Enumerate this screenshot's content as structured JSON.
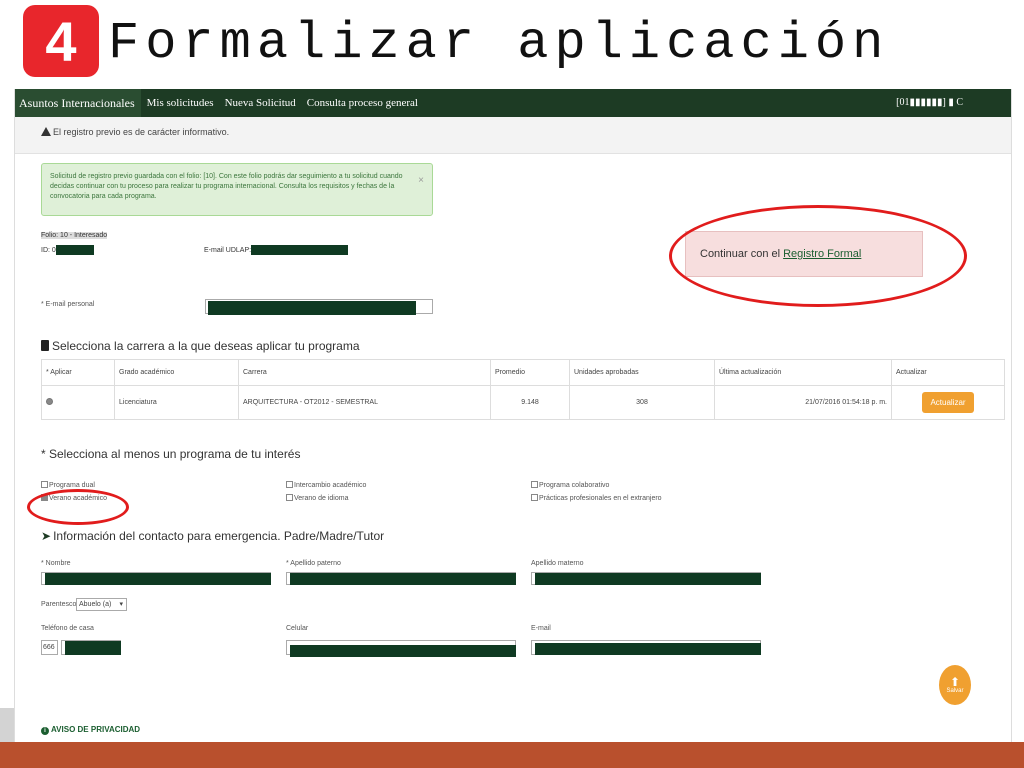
{
  "slide": {
    "step_number": "4",
    "title": "Formalizar aplicación"
  },
  "nav": {
    "brand": "Asuntos Internacionales",
    "links": [
      "Mis solicitudes",
      "Nueva Solicitud",
      "Consulta proceso general"
    ],
    "user": "[01▮▮▮▮▮▮] ▮ C"
  },
  "notice": {
    "text": "El registro previo es de carácter informativo.",
    "icon": "warning-icon"
  },
  "alert": {
    "text": "Solicitud de registro previo guardada con el folio: [10]. Con este folio podrás dar seguimiento a tu solicitud cuando decidas continuar con tu proceso para realizar tu programa internacional. Consulta los requisitos y fechas de la convocatoria para cada programa.",
    "close": "×"
  },
  "applicant": {
    "folio": "Folio: 10 - Interesado",
    "id_label": "ID: 0",
    "email_label": "E-mail UDLAP:"
  },
  "continue_box": {
    "text": "Continuar con el",
    "link": "Registro Formal"
  },
  "personal_email": {
    "label": "* E-mail personal"
  },
  "career_section": {
    "title": "Selecciona la carrera a la que deseas aplicar tu programa",
    "headers": [
      "* Aplicar",
      "Grado académico",
      "Carrera",
      "Promedio",
      "Unidades aprobadas",
      "Última actualización",
      "Actualizar"
    ],
    "row": {
      "grado": "Licenciatura",
      "carrera": "ARQUITECTURA - OT2012 - SEMESTRAL",
      "promedio": "9.148",
      "unidades": "308",
      "actualizacion": "21/07/2016 01:54:18 p. m.",
      "button": "Actualizar"
    }
  },
  "programs_section": {
    "title": "* Selecciona al menos un programa de tu interés",
    "options": [
      {
        "label": "Programa dual",
        "checked": false
      },
      {
        "label": "Verano académico",
        "checked": true
      },
      {
        "label": "Intercambio académico",
        "checked": false
      },
      {
        "label": "Verano de idioma",
        "checked": false
      },
      {
        "label": "Programa colaborativo",
        "checked": false
      },
      {
        "label": "Prácticas profesionales en el extranjero",
        "checked": false
      }
    ]
  },
  "emergency_section": {
    "title": "Información del contacto para emergencia. Padre/Madre/Tutor",
    "nombre_label": "* Nombre",
    "apellido_paterno_label": "* Apellido paterno",
    "apellido_materno_label": "Apellido materno",
    "parentesco_label": "Parentesco",
    "parentesco_value": "Abuelo (a)",
    "telefono_label": "Teléfono de casa",
    "lada": "666",
    "celular_label": "Celular",
    "email_label": "E-mail"
  },
  "save": {
    "label": "Salvar"
  },
  "privacy": {
    "label": "AVISO DE PRIVACIDAD"
  },
  "colors": {
    "nav_bg": "#1d3b24",
    "accent_orange": "#f0a030",
    "highlight_red": "#e11c1c",
    "step_badge": "#e8262c",
    "bottom_band": "#b9502d"
  }
}
